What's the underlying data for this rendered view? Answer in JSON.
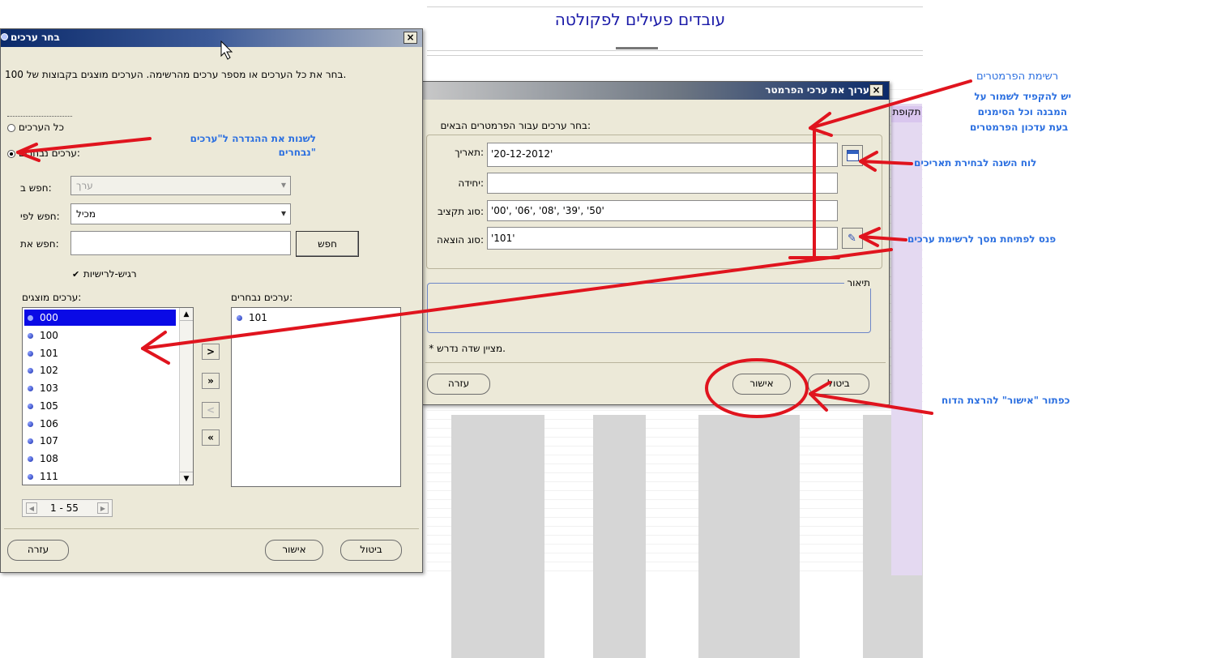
{
  "report": {
    "title": "עובדים פעילים לפקולטה",
    "period_header": "תקופת"
  },
  "right_dialog": {
    "title": "ערוך את ערכי הפרמטר",
    "instruction": "בחר ערכים עבור הפרמטרים הבאים:",
    "params": [
      {
        "label": "תאריך:",
        "value": "'20-12-2012'"
      },
      {
        "label": "יחידה:",
        "value": ""
      },
      {
        "label": "סוג תקציב:",
        "value": "'00', '06', '08', '39', '50'"
      },
      {
        "label": "סוג הוצאה:",
        "value": "'101'"
      }
    ],
    "description_label": "תיאור",
    "required_note": "* מציין שדה נדרש.",
    "help_button": "עזרה",
    "ok_button": "אישור",
    "cancel_button": "ביטול"
  },
  "left_dialog": {
    "title": "בחר ערכים",
    "instruction": "בחר את כל הערכים או מספר ערכים מהרשימה. הערכים מוצגים בקבוצות של 100.",
    "all_values": "כל הערכים",
    "selected_values": "ערכים נבחרים:",
    "search_in_label": "חפש ב:",
    "search_in_value": "ערך",
    "search_by_label": "חפש לפי:",
    "search_by_value": "מכיל",
    "search_for_label": "חפש את:",
    "search_for_value": "",
    "search_button": "חפש",
    "case_sensitive": "רגיש-לרישיות",
    "shown_values_header": "ערכים מוצגים:",
    "chosen_values_header": "ערכים נבחרים:",
    "shown_values": [
      "000",
      "100",
      "101",
      "102",
      "103",
      "105",
      "106",
      "107",
      "108",
      "111"
    ],
    "chosen_values": [
      "101"
    ],
    "range": "1 - 55",
    "help_button": "עזרה",
    "ok_button": "אישור",
    "cancel_button": "ביטול"
  },
  "annotations": {
    "param_list_title": "רשימת הפרמטרים",
    "param_list_note_1": "יש להקפיד לשמור על",
    "param_list_note_2": "המבנה וכל הסימנים",
    "param_list_note_3": "בעת עדכון הפרמטרים",
    "calendar_note": "לוח השנה לבחירת תאריכים",
    "pencil_note": "פנס לפתיחת מסך לרשימת ערכים",
    "change_setting_1": "לשנות את ההגדרה ל\"ערכים",
    "change_setting_2": "נבחרים\"",
    "ok_note": "כפתור \"אישור\" להרצת הדוח"
  },
  "colors": {
    "annotation_blue": "#2b6fe0",
    "arrow_red": "#e0141e",
    "selection_blue": "#0a0ae6",
    "title_blue": "#1a1aa8"
  }
}
